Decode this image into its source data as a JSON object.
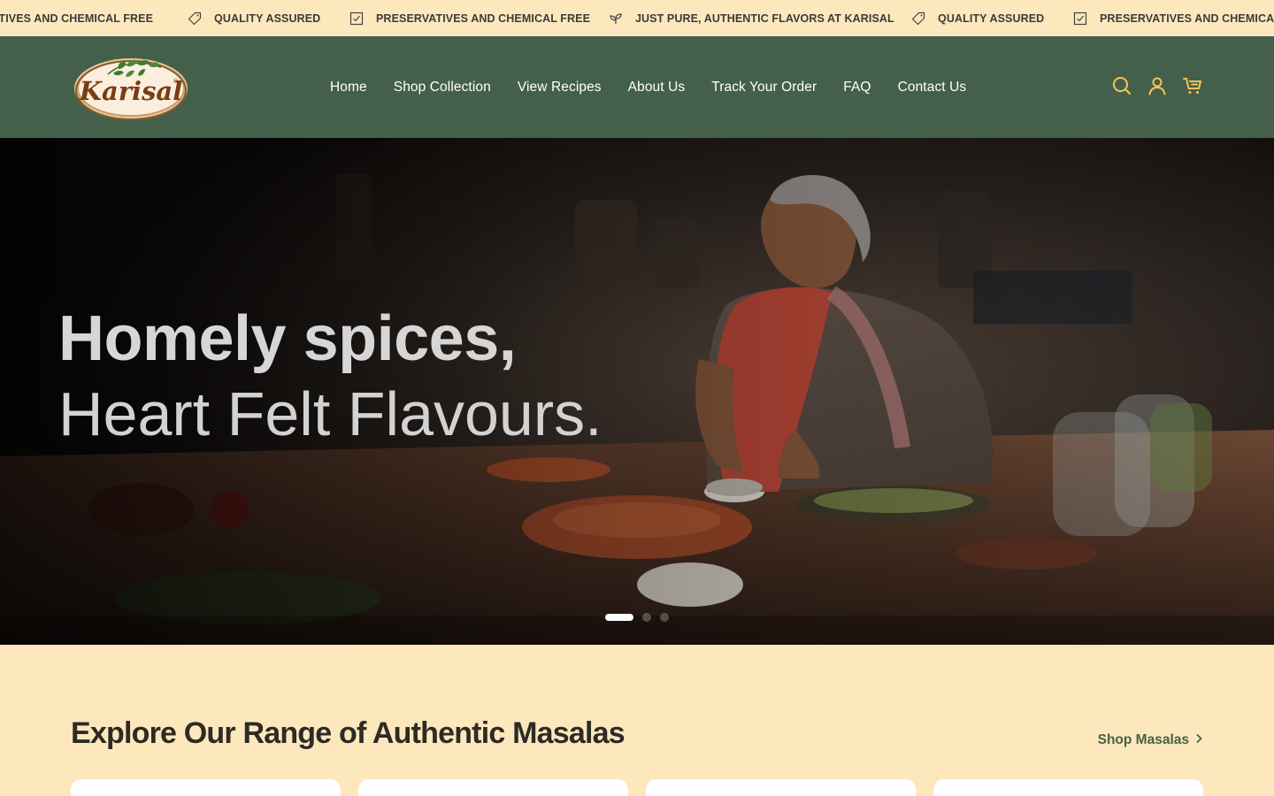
{
  "ticker": {
    "items": [
      {
        "text": "PRESERVATIVES AND CHEMICAL FREE",
        "icon": "check-box-icon"
      },
      {
        "text": "QUALITY ASSURED",
        "icon": "tag-icon"
      },
      {
        "text": "PRESERVATIVES AND CHEMICAL FREE",
        "icon": "check-box-icon"
      },
      {
        "text": "JUST PURE, AUTHENTIC FLAVORS AT KARISAL",
        "icon": "leaf-icon"
      },
      {
        "text": "QUALITY ASSURED",
        "icon": "tag-icon"
      },
      {
        "text": "PRESERVATIVES AND CHEMICAL FREE",
        "icon": "check-box-icon"
      }
    ]
  },
  "brand": {
    "name": "Karisal",
    "colors": {
      "header": "#45604a",
      "cream": "#fce8bc",
      "logo_brown": "#7a3d12"
    }
  },
  "nav": {
    "items": [
      {
        "label": "Home"
      },
      {
        "label": "Shop Collection"
      },
      {
        "label": "View Recipes"
      },
      {
        "label": "About Us"
      },
      {
        "label": "Track Your Order"
      },
      {
        "label": "FAQ"
      },
      {
        "label": "Contact Us"
      }
    ]
  },
  "header_icons": [
    "search-icon",
    "account-icon",
    "cart-icon"
  ],
  "hero": {
    "line1": "Homely spices,",
    "line2": "Heart Felt Flavours.",
    "slide_count": 3,
    "active_slide": 1
  },
  "section": {
    "title": "Explore Our Range of Authentic Masalas",
    "link_label": "Shop Masalas"
  }
}
